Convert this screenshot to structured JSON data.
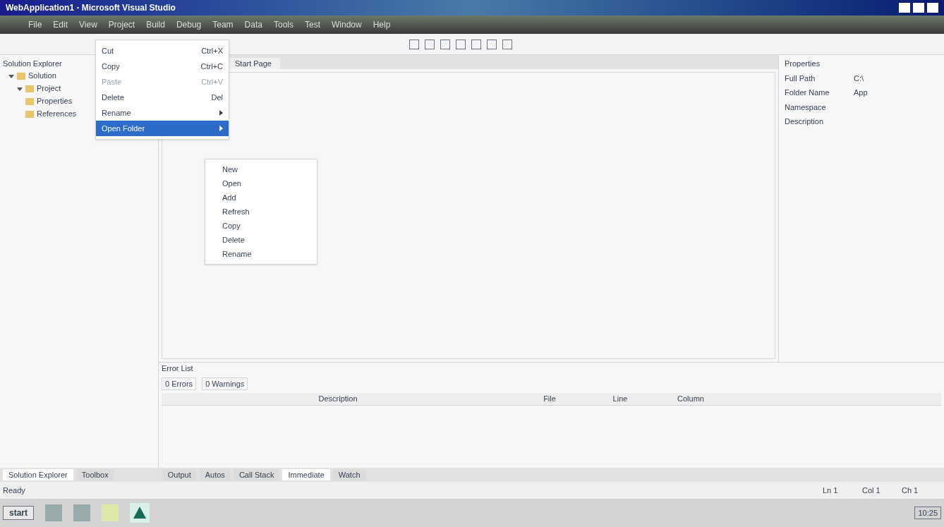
{
  "window": {
    "title": "WebApplication1 - Microsoft Visual Studio"
  },
  "menu": [
    "File",
    "Edit",
    "View",
    "Project",
    "Build",
    "Debug",
    "Team",
    "Data",
    "Tools",
    "Test",
    "Window",
    "Help"
  ],
  "solution_explorer": {
    "title": "Solution Explorer",
    "tree": [
      {
        "label": "Solution",
        "expanded": true,
        "children": [
          {
            "label": "Project",
            "expanded": true,
            "children": [
              {
                "label": "Properties"
              },
              {
                "label": "References"
              }
            ]
          }
        ]
      }
    ]
  },
  "context_menu": {
    "items": [
      {
        "kind": "item",
        "label": "Cut",
        "shortcut": "Ctrl+X",
        "disabled": false,
        "selected": false
      },
      {
        "kind": "item",
        "label": "Copy",
        "shortcut": "Ctrl+C",
        "disabled": false,
        "selected": false
      },
      {
        "kind": "item",
        "label": "Paste",
        "shortcut": "Ctrl+V",
        "disabled": true,
        "selected": false
      },
      {
        "kind": "item",
        "label": "Delete",
        "shortcut": "Del",
        "disabled": false,
        "selected": false
      },
      {
        "kind": "submenu",
        "label": "Rename",
        "disabled": false,
        "selected": false
      },
      {
        "kind": "submenu",
        "label": "Open Folder",
        "disabled": false,
        "selected": true
      }
    ]
  },
  "submenu": {
    "items": [
      "New",
      "Open",
      "Add",
      "Refresh",
      "Copy",
      "Delete",
      "Rename"
    ]
  },
  "document_tab": {
    "label": "Start Page"
  },
  "properties": {
    "title": "Properties",
    "rows": [
      {
        "name": "Full Path",
        "value": "C:\\"
      },
      {
        "name": "Folder Name",
        "value": "App"
      },
      {
        "name": "Namespace"
      },
      {
        "name": "Description"
      }
    ]
  },
  "output_panel": {
    "title": "Error List",
    "filters": [
      "0 Errors",
      "0 Warnings"
    ],
    "columns": [
      "Description",
      "File",
      "Line",
      "Column"
    ]
  },
  "left_tabs": [
    {
      "label": "Solution Explorer",
      "selected": true
    },
    {
      "label": "Toolbox",
      "selected": false
    }
  ],
  "bottom_tabs": [
    {
      "label": "Output",
      "selected": false
    },
    {
      "label": "Autos",
      "selected": false
    },
    {
      "label": "Call Stack",
      "selected": false
    },
    {
      "label": "Immediate",
      "selected": true
    },
    {
      "label": "Watch",
      "selected": false
    }
  ],
  "status": {
    "text": "Ready",
    "ln": "Ln 1",
    "col": "Col 1",
    "ch": "Ch 1"
  },
  "taskbar": {
    "start": "start",
    "clock": "10:25"
  }
}
